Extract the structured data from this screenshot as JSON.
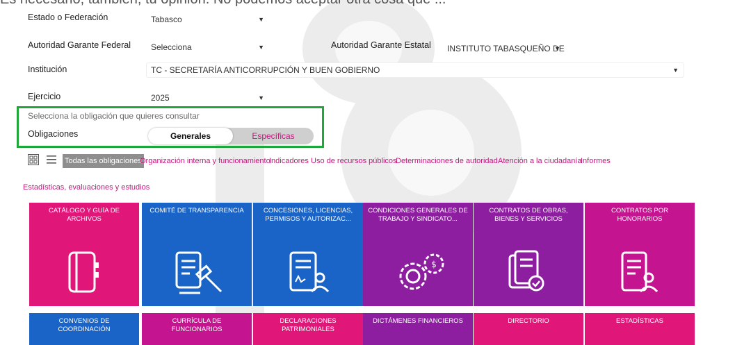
{
  "top_cut_text": "Es necesario, también, tu opinión. No podemos aceptar otra cosa que ...",
  "filters": {
    "estado_label": "Estado o Federación",
    "estado_value": "Tabasco",
    "autoridad_federal_label": "Autoridad Garante Federal",
    "autoridad_federal_value": "Selecciona",
    "autoridad_estatal_label": "Autoridad Garante Estatal",
    "autoridad_estatal_value": "INSTITUTO TABASQUEÑO DE",
    "institucion_label": "Institución",
    "institucion_value": "TC - SECRETARÍA ANTICORRUPCIÓN Y BUEN GOBIERNO",
    "ejercicio_label": "Ejercicio",
    "ejercicio_value": "2025"
  },
  "obligation_selector": {
    "hint": "Selecciona la obligación que quieres consultar",
    "label": "Obligaciones",
    "option_generales": "Generales",
    "option_especificas": "Específicas",
    "selected": "Generales"
  },
  "tabs": {
    "active": "Todas las obligaciones",
    "items": [
      "Organización interna y funcionamiento",
      "Indicadores",
      "Uso de recursos públicos",
      "Determinaciones de autoridad",
      "Atención a la ciudadanía",
      "Informes",
      "Estadísticas, evaluaciones y estudios"
    ]
  },
  "tiles_row1": [
    {
      "title": "CATÁLOGO Y GUÍA DE ARCHIVOS",
      "color": "#e01679",
      "icon": "binder-icon"
    },
    {
      "title": "COMITÉ DE TRANSPARENCIA",
      "color": "#1a64c8",
      "icon": "gavel-document-icon"
    },
    {
      "title": "CONCESIONES, LICENCIAS, PERMISOS Y AUTORIZAC...",
      "color": "#1a64c8",
      "icon": "signed-document-icon"
    },
    {
      "title": "CONDICIONES GENERALES DE TRABAJO Y SINDICATO...",
      "color": "#8d1ea0",
      "icon": "gears-money-icon"
    },
    {
      "title": "CONTRATOS DE OBRAS, BIENES Y SERVICIOS",
      "color": "#8d1ea0",
      "icon": "approved-documents-icon"
    },
    {
      "title": "CONTRATOS POR HONORARIOS",
      "color": "#c4148f",
      "icon": "person-document-icon"
    }
  ],
  "tiles_row2": [
    {
      "title": "CONVENIOS DE COORDINACIÓN",
      "color": "#1a64c8"
    },
    {
      "title": "CURRÍCULA DE FUNCIONARIOS",
      "color": "#c4148f"
    },
    {
      "title": "DECLARACIONES PATRIMONIALES",
      "color": "#e01679"
    },
    {
      "title": "DICTÁMENES FINANCIEROS",
      "color": "#8d1ea0"
    },
    {
      "title": "DIRECTORIO",
      "color": "#e01679"
    },
    {
      "title": "ESTADÍSTICAS",
      "color": "#e01679"
    }
  ]
}
